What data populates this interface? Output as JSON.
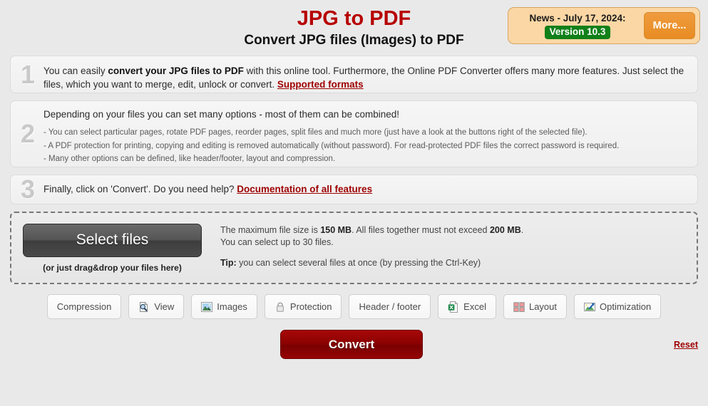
{
  "header": {
    "title": "JPG to PDF",
    "subtitle": "Convert JPG files (Images) to PDF",
    "news": {
      "headline": "News - July 17, 2024:",
      "version_badge": "Version 10.3",
      "more_label": "More...",
      "badge_color": "#118019",
      "box_color": "#fbd7a5",
      "more_color": "#e88c23"
    },
    "title_color": "#b70000"
  },
  "steps": [
    {
      "number": "1",
      "lead_pre": "You can easily ",
      "lead_bold": "convert your JPG files to PDF",
      "lead_post": " with this online tool. Furthermore, the Online PDF Converter offers many more features. Just select the files, which you want to merge, edit, unlock or convert. ",
      "link": "Supported formats"
    },
    {
      "number": "2",
      "lead": "Depending on your files you can set many options - most of them can be combined!",
      "bullets": [
        "- You can select particular pages, rotate PDF pages, reorder pages, split files and much more (just have a look at the buttons right of the selected file).",
        "- A PDF protection for printing, copying and editing is removed automatically (without password). For read-protected PDF files the correct password is required.",
        "- Many other options can be defined, like header/footer, layout and compression."
      ]
    },
    {
      "number": "3",
      "lead": "Finally, click on 'Convert'. Do you need help? ",
      "link": "Documentation of all features"
    }
  ],
  "dropzone": {
    "select_label": "Select files",
    "drag_note": "(or just drag&drop your files here)",
    "limit_line1_pre": "The maximum file size is ",
    "limit_line1_b1": "150 MB",
    "limit_line1_mid": ". All files together must not exceed ",
    "limit_line1_b2": "200 MB",
    "limit_line1_post": ".",
    "limit_line2": "You can select up to 30 files.",
    "tip_label": "Tip:",
    "tip_text": " you can select several files at once (by pressing the Ctrl-Key)"
  },
  "options": [
    {
      "label": "Compression",
      "icon": "none"
    },
    {
      "label": "View",
      "icon": "document-magnifier-icon"
    },
    {
      "label": "Images",
      "icon": "photo-icon"
    },
    {
      "label": "Protection",
      "icon": "padlock-icon"
    },
    {
      "label": "Header / footer",
      "icon": "none"
    },
    {
      "label": "Excel",
      "icon": "excel-document-icon"
    },
    {
      "label": "Layout",
      "icon": "grid-squares-icon"
    },
    {
      "label": "Optimization",
      "icon": "chart-arrow-icon"
    }
  ],
  "actions": {
    "convert_label": "Convert",
    "reset_label": "Reset",
    "convert_color": "#8d0202"
  }
}
